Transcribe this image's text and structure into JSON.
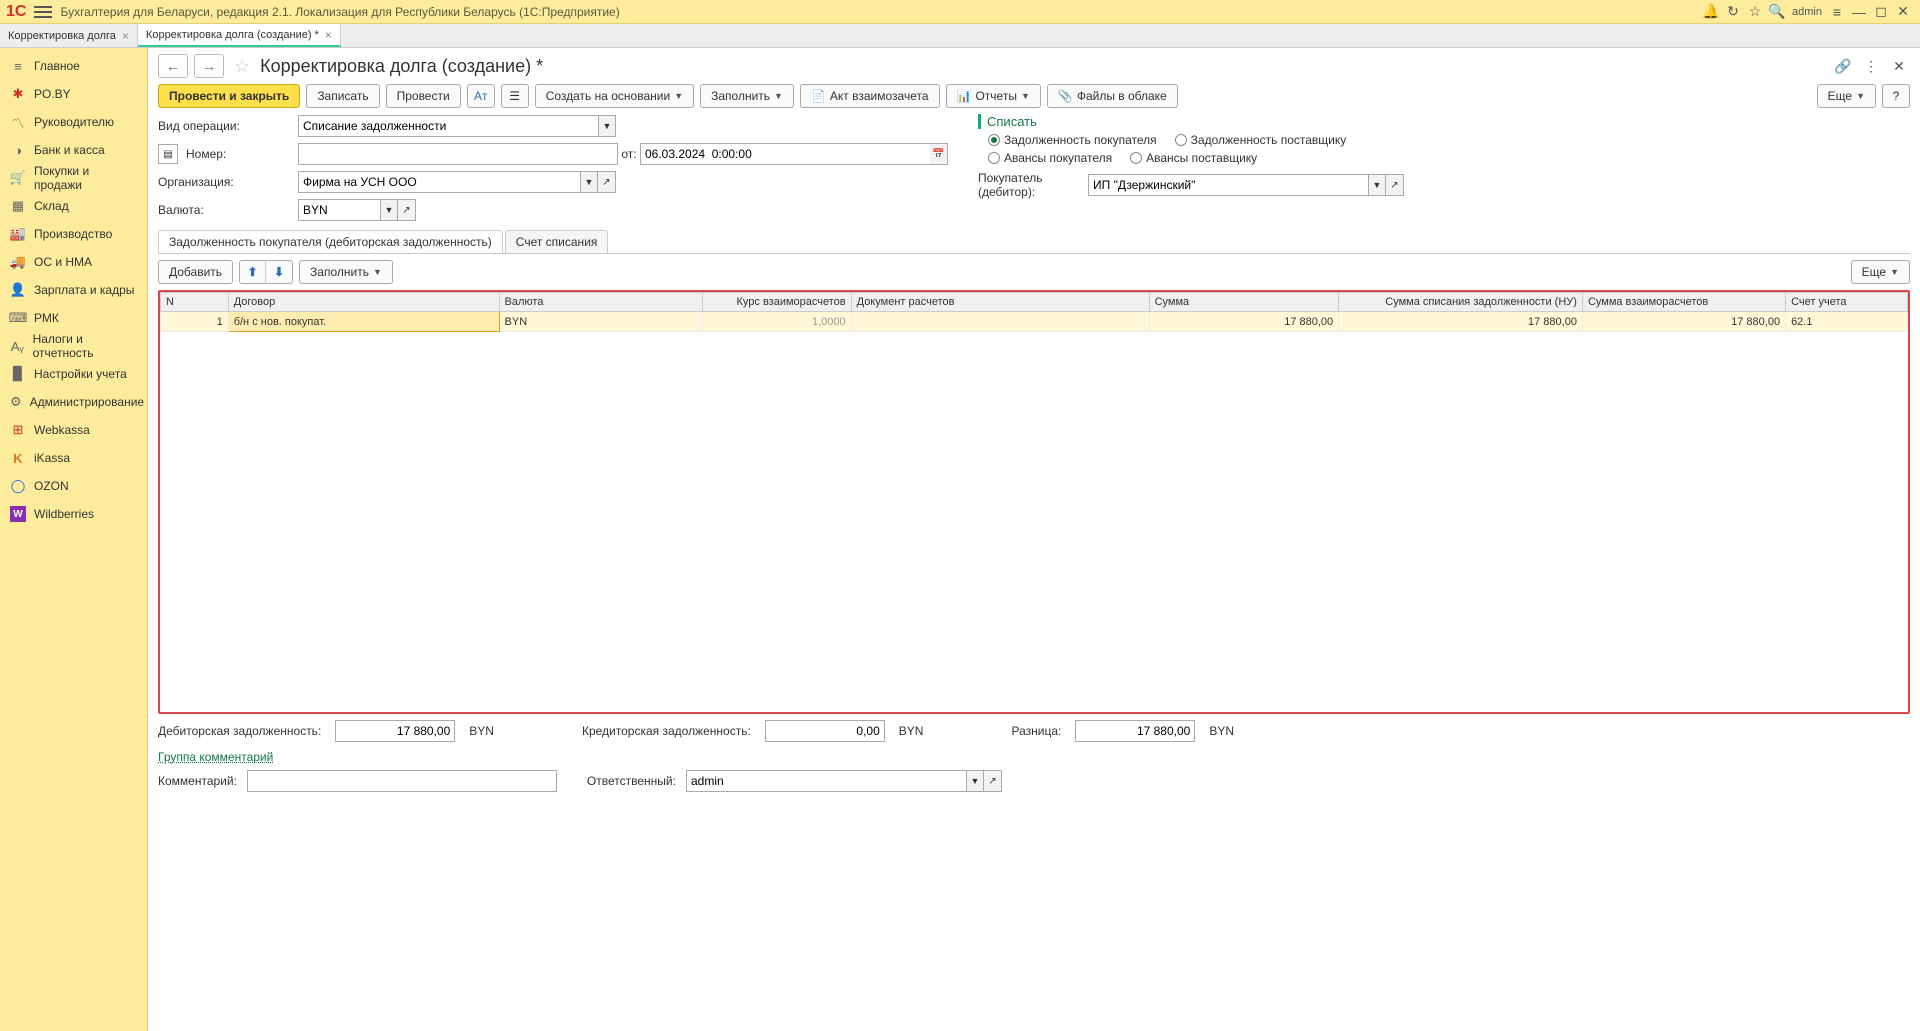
{
  "app": {
    "title": "Бухгалтерия для Беларуси, редакция 2.1. Локализация для Республики Беларусь  (1С:Предприятие)",
    "user": "admin"
  },
  "tabs": [
    {
      "label": "Корректировка долга",
      "active": false
    },
    {
      "label": "Корректировка долга (создание) *",
      "active": true
    }
  ],
  "sidebar": {
    "items": [
      {
        "label": "Главное"
      },
      {
        "label": "PO.BY"
      },
      {
        "label": "Руководителю"
      },
      {
        "label": "Банк и касса"
      },
      {
        "label": "Покупки и продажи"
      },
      {
        "label": "Склад"
      },
      {
        "label": "Производство"
      },
      {
        "label": "ОС и НМА"
      },
      {
        "label": "Зарплата и кадры"
      },
      {
        "label": "РМК"
      },
      {
        "label": "Налоги и отчетность"
      },
      {
        "label": "Настройки учета"
      },
      {
        "label": "Администрирование"
      },
      {
        "label": "Webkassa"
      },
      {
        "label": "iKassa"
      },
      {
        "label": "OZON"
      },
      {
        "label": "Wildberries"
      }
    ]
  },
  "doc": {
    "title": "Корректировка долга (создание) *",
    "toolbar": {
      "post_close": "Провести и закрыть",
      "save": "Записать",
      "post": "Провести",
      "create_based": "Создать на основании",
      "fill": "Заполнить",
      "act": "Акт взаимозачета",
      "reports": "Отчеты",
      "files": "Файлы в облаке",
      "more": "Еще"
    },
    "fields": {
      "op_label": "Вид операции:",
      "op_value": "Списание задолженности",
      "num_label": "Номер:",
      "num_value": "",
      "date_label": "от:",
      "date_value": "06.03.2024  0:00:00",
      "org_label": "Организация:",
      "org_value": "Фирма на УСН ООО",
      "cur_label": "Валюта:",
      "cur_value": "BYN"
    },
    "writeoff": {
      "title": "Списать",
      "r1": "Задолженность покупателя",
      "r2": "Задолженность поставщику",
      "r3": "Авансы покупателя",
      "r4": "Авансы поставщику",
      "buyer_label": "Покупатель (дебитор):",
      "buyer_value": "ИП \"Дзержинский\""
    },
    "ctabs": {
      "t1": "Задолженность покупателя (дебиторская задолженность)",
      "t2": "Счет списания"
    },
    "tbltool": {
      "add": "Добавить",
      "fill": "Заполнить",
      "more": "Еще"
    },
    "grid": {
      "h_n": "N",
      "h_contract": "Договор",
      "h_cur": "Валюта",
      "h_rate": "Курс взаиморасчетов",
      "h_doc": "Документ расчетов",
      "h_sum": "Сумма",
      "h_wosum": "Сумма списания задолженности (НУ)",
      "h_settle": "Сумма взаиморасчетов",
      "h_acc": "Счет учета",
      "rows": [
        {
          "n": "1",
          "contract": "б/н с нов. покупат.",
          "cur": "BYN",
          "rate": "1,0000",
          "doc": "",
          "sum": "17 880,00",
          "wosum": "17 880,00",
          "settle": "17 880,00",
          "acc": "62.1"
        }
      ]
    },
    "footer": {
      "deb_label": "Дебиторская задолженность:",
      "deb_value": "17 880,00",
      "cur1": "BYN",
      "cred_label": "Кредиторская задолженность:",
      "cred_value": "0,00",
      "cur2": "BYN",
      "diff_label": "Разница:",
      "diff_value": "17 880,00",
      "cur3": "BYN",
      "group_link": "Группа комментарий",
      "comment_label": "Комментарий:",
      "resp_label": "Ответственный:",
      "resp_value": "admin"
    }
  }
}
